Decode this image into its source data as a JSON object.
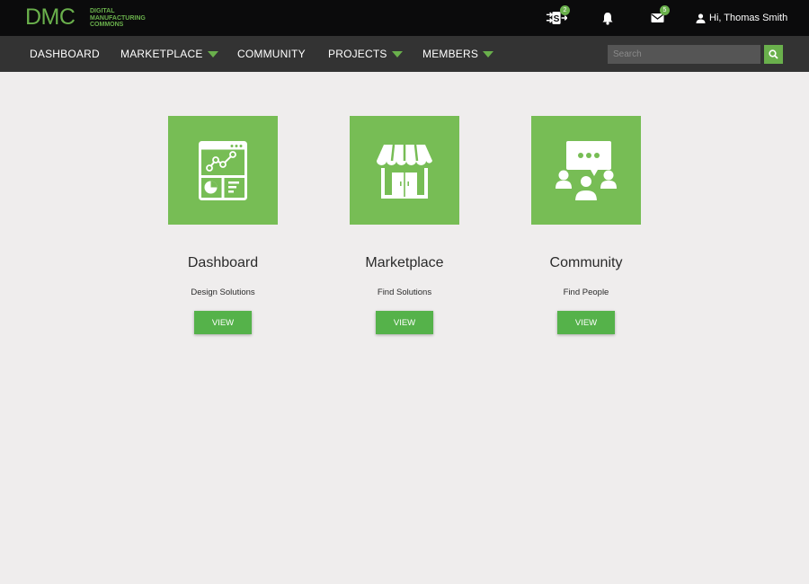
{
  "brand": {
    "logo_text": "DMC",
    "logo_sub": [
      "DIGITAL",
      "MANUFACTURING",
      "COMMONS"
    ],
    "accent": "#6ab04c"
  },
  "header": {
    "icons": [
      {
        "icon": "swap-s-icon",
        "badge": "2"
      },
      {
        "icon": "bell-icon",
        "badge": ""
      },
      {
        "icon": "mail-icon",
        "badge": "5"
      }
    ],
    "user_icon": "person-icon",
    "user_greeting": "Hi, Thomas Smith"
  },
  "nav": {
    "items": [
      {
        "label": "DASHBOARD",
        "dropdown": false
      },
      {
        "label": "MARKETPLACE",
        "dropdown": true
      },
      {
        "label": "COMMUNITY",
        "dropdown": false
      },
      {
        "label": "PROJECTS",
        "dropdown": true
      },
      {
        "label": "MEMBERS",
        "dropdown": true
      }
    ],
    "search": {
      "placeholder": "Search",
      "value": "",
      "icon": "search-icon"
    }
  },
  "cards": [
    {
      "icon": "dashboard-icon",
      "title": "Dashboard",
      "subtitle": "Design Solutions",
      "button": "VIEW"
    },
    {
      "icon": "storefront-icon",
      "title": "Marketplace",
      "subtitle": "Find Solutions",
      "button": "VIEW"
    },
    {
      "icon": "community-icon",
      "title": "Community",
      "subtitle": "Find People",
      "button": "VIEW"
    }
  ]
}
